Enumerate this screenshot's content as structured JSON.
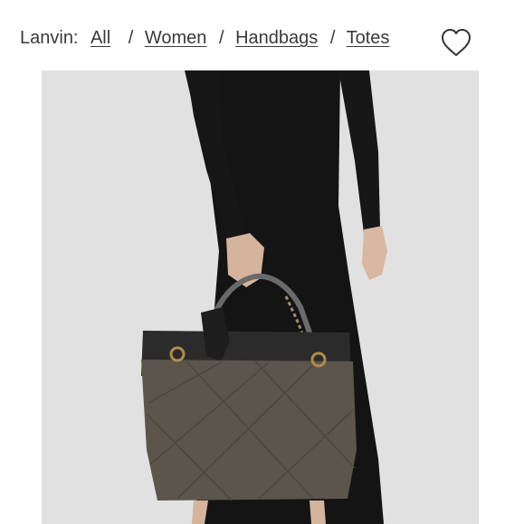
{
  "breadcrumb": {
    "brand": "Lanvin:",
    "items": [
      {
        "label": "All"
      },
      {
        "label": "Women"
      },
      {
        "label": "Handbags"
      },
      {
        "label": "Totes"
      }
    ],
    "separator": "/"
  },
  "header": {
    "favorite_icon": "heart-outline-icon"
  },
  "colors": {
    "text": "#3a3a3a",
    "photo_background": "#e0e0e0",
    "dress": "#141414",
    "bag_body": "#5b554b",
    "bag_top": "#2e2e2e"
  }
}
